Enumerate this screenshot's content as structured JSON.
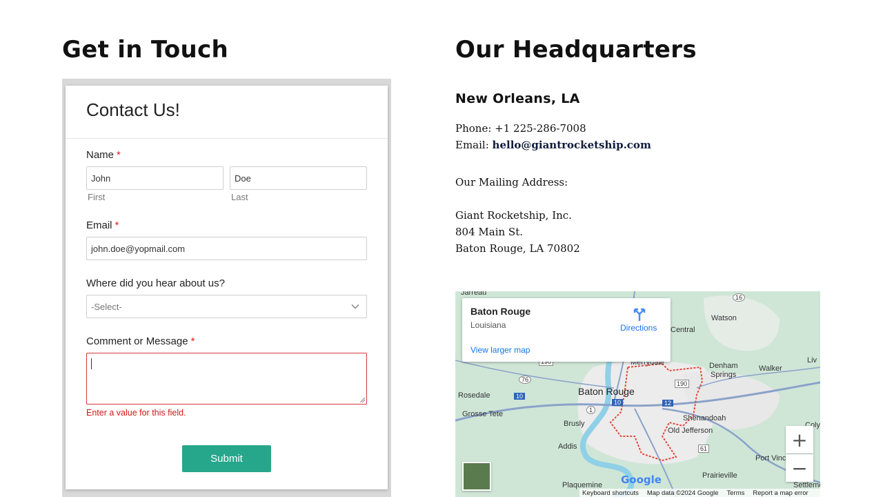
{
  "left": {
    "title": "Get in Touch"
  },
  "form": {
    "heading": "Contact Us!",
    "name_label": "Name",
    "required_mark": "*",
    "first_value": "John",
    "last_value": "Doe",
    "first_sub": "First",
    "last_sub": "Last",
    "email_label": "Email",
    "email_value": "john.doe@yopmail.com",
    "source_label": "Where did you hear about us?",
    "source_selected": "-Select-",
    "message_label": "Comment or Message",
    "message_value": "",
    "error_text": "Enter a value for this field.",
    "submit_label": "Submit"
  },
  "right": {
    "title": "Our Headquarters",
    "city": "New Orleans, LA",
    "phone_label": "Phone:",
    "phone": "+1 225-286-7008",
    "email_label": "Email:",
    "email": "hello@giantrocketship.com",
    "mailing_label": "Our Mailing Address:",
    "company": "Giant Rocketship, Inc.",
    "street": "804 Main St.",
    "city_line": "Baton Rouge, LA 70802"
  },
  "map": {
    "place_title": "Baton Rouge",
    "place_sub": "Louisiana",
    "directions": "Directions",
    "larger_map": "View larger map",
    "zoom_in": "+",
    "zoom_out": "−",
    "footer_shortcuts": "Keyboard shortcuts",
    "footer_data": "Map data ©2024 Google",
    "footer_terms": "Terms",
    "footer_report": "Report a map error",
    "logo": "Google",
    "labels": {
      "baton_rouge": "Baton Rouge",
      "central": "Central",
      "watson": "Watson",
      "denham": "Denham",
      "springs": "Springs",
      "walker": "Walker",
      "merrydale": "Merrydale",
      "rosedale": "Rosedale",
      "grosse_tete": "Grosse Tete",
      "brusly": "Brusly",
      "shenandoah": "Shenandoah",
      "old_jefferson": "Old Jefferson",
      "addis": "Addis",
      "port_vincent": "Port Vinc",
      "prairieville": "Prairieville",
      "plaquemine": "Plaquemine",
      "settlement": "Settleme",
      "jarreau": "Jarreau",
      "liv": "Liv",
      "coly": "Coly"
    },
    "route_labels": {
      "r16": "16",
      "r190a": "190",
      "r190b": "190",
      "r76": "76",
      "r10a": "10",
      "r10b": "10",
      "r12": "12",
      "r1": "1",
      "r61": "61"
    },
    "colors": {
      "water": "#8fd0e6",
      "land": "#cfe6d7",
      "urban": "#ececec",
      "boundary": "#e04a3a",
      "road": "#8aa2c9"
    }
  }
}
